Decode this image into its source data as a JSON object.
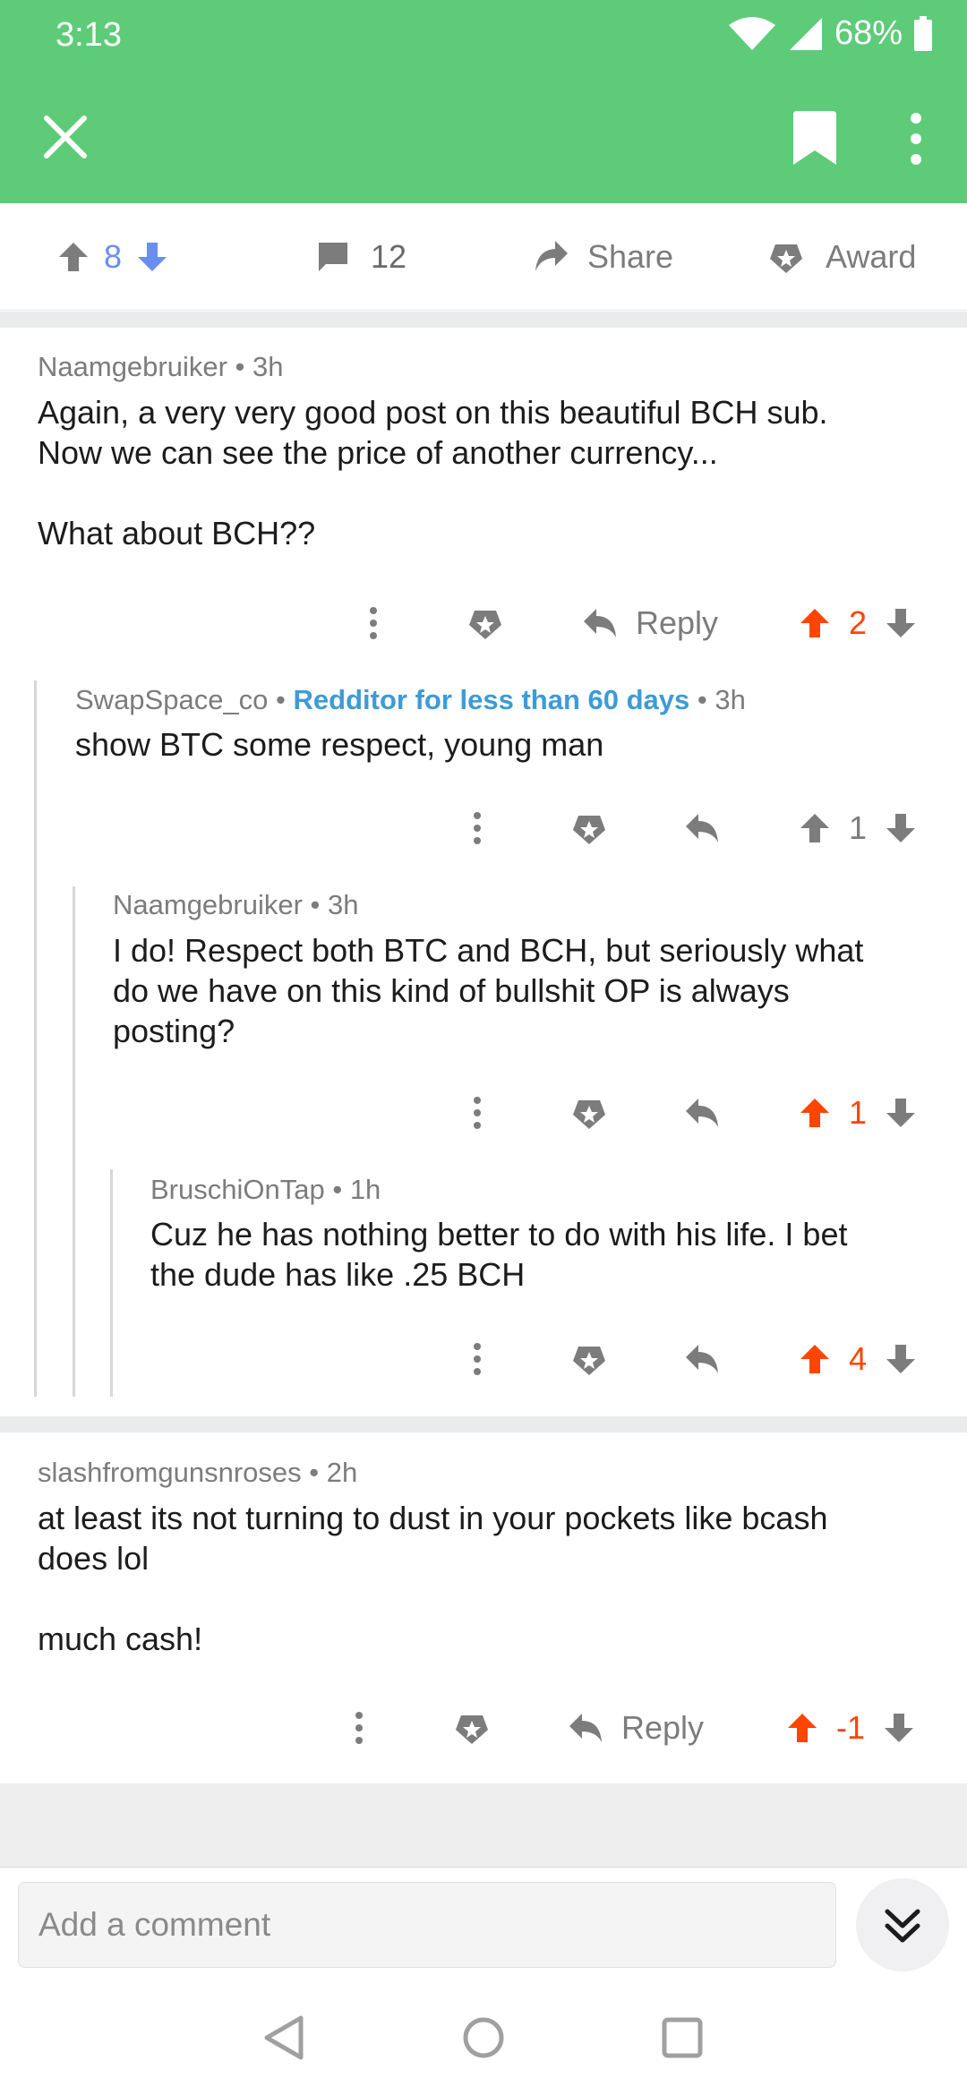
{
  "status_bar": {
    "time": "3:13",
    "battery": "68%"
  },
  "post_actions": {
    "score": "8",
    "comments": "12",
    "share_label": "Share",
    "award_label": "Award"
  },
  "comments": [
    {
      "author": "Naamgebruiker",
      "age": "3h",
      "body_lines": [
        "Again, a very very good post on this beautiful BCH sub.",
        "Now we can see the price of another currency...",
        "",
        "What about BCH??"
      ],
      "reply_label": "Reply",
      "score": "2"
    },
    {
      "author": "SwapSpace_co",
      "badge": "Redditor for less than 60 days",
      "age": "3h",
      "body_lines": [
        "show BTC some respect, young man"
      ],
      "score": "1"
    },
    {
      "author": "Naamgebruiker",
      "age": "3h",
      "body_lines": [
        "I do! Respect both BTC and BCH, but seriously what",
        "do we have on this kind of bullshit OP is always",
        "posting?"
      ],
      "score": "1"
    },
    {
      "author": "BruschiOnTap",
      "age": "1h",
      "body_lines": [
        "Cuz he has nothing better to do with his life. I bet",
        "the dude has like .25 BCH"
      ],
      "score": "4"
    },
    {
      "author": "slashfromgunsnroses",
      "age": "2h",
      "body_lines": [
        "at least its not turning to dust in your pockets like bcash",
        "does lol",
        "",
        "much cash!"
      ],
      "reply_label": "Reply",
      "score": "-1"
    }
  ],
  "composer": {
    "placeholder": "Add a comment"
  },
  "colors": {
    "app_bar": "#5ecb78",
    "upvote": "#ff4500",
    "post_vote": "#6a8ef0",
    "newbie_badge": "#3d9bd6"
  }
}
